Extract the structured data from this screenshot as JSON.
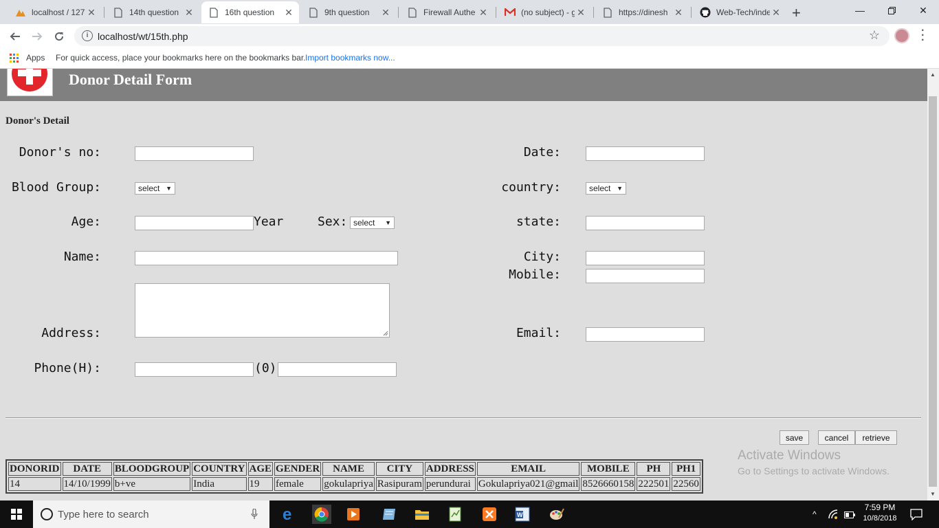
{
  "browser": {
    "tabs": [
      {
        "title": "localhost / 127",
        "icon": "phpmyadmin-icon"
      },
      {
        "title": "14th question",
        "icon": "page-icon"
      },
      {
        "title": "16th question",
        "icon": "page-icon",
        "active": true
      },
      {
        "title": "9th question",
        "icon": "page-icon"
      },
      {
        "title": "Firewall Authe",
        "icon": "page-icon"
      },
      {
        "title": "(no subject) - g",
        "icon": "gmail-icon"
      },
      {
        "title": "https://dinesh",
        "icon": "page-icon"
      },
      {
        "title": "Web-Tech/inde",
        "icon": "github-icon"
      }
    ],
    "url": "localhost/wt/15th.php",
    "bookmarks": {
      "apps_label": "Apps",
      "hint": "For quick access, place your bookmarks here on the bookmarks bar.",
      "import_link": "Import bookmarks now..."
    }
  },
  "page": {
    "title": "Donor Detail Form",
    "section_heading": "Donor's Detail",
    "labels": {
      "donor_no": "Donor's no:",
      "date": "Date:",
      "blood_group": "Blood Group:",
      "country": "country:",
      "age": "Age:",
      "year": "Year",
      "sex": "Sex:",
      "state": "state:",
      "name": "Name:",
      "city": "City:",
      "mobile": "Mobile:",
      "address": "Address:",
      "email": "Email:",
      "phone_h": "Phone(H):",
      "phone_o": "(0)"
    },
    "selects": {
      "blood_group": "select",
      "country": "select",
      "sex": "select"
    },
    "buttons": {
      "save": "save",
      "cancel": "cancel",
      "retrieve": "retrieve"
    },
    "table": {
      "headers": [
        "DONORID",
        "DATE",
        "BLOODGROUP",
        "COUNTRY",
        "AGE",
        "GENDER",
        "NAME",
        "CITY",
        "ADDRESS",
        "EMAIL",
        "MOBILE",
        "PH",
        "PH1"
      ],
      "rows": [
        [
          "14",
          "14/10/1999",
          "b+ve",
          "India",
          "19",
          "female",
          "gokulapriya",
          "Rasipuram",
          "perundurai",
          "Gokulapriya021@gmail",
          "8526660158",
          "222501",
          "22560"
        ]
      ]
    }
  },
  "watermark": {
    "line1": "Activate Windows",
    "line2": "Go to Settings to activate Windows."
  },
  "taskbar": {
    "search_placeholder": "Type here to search",
    "time": "7:59 PM",
    "date": "10/8/2018"
  },
  "colors": {
    "header_band": "#808080",
    "page_bg": "#dedede",
    "logo_red": "#e3262b"
  }
}
